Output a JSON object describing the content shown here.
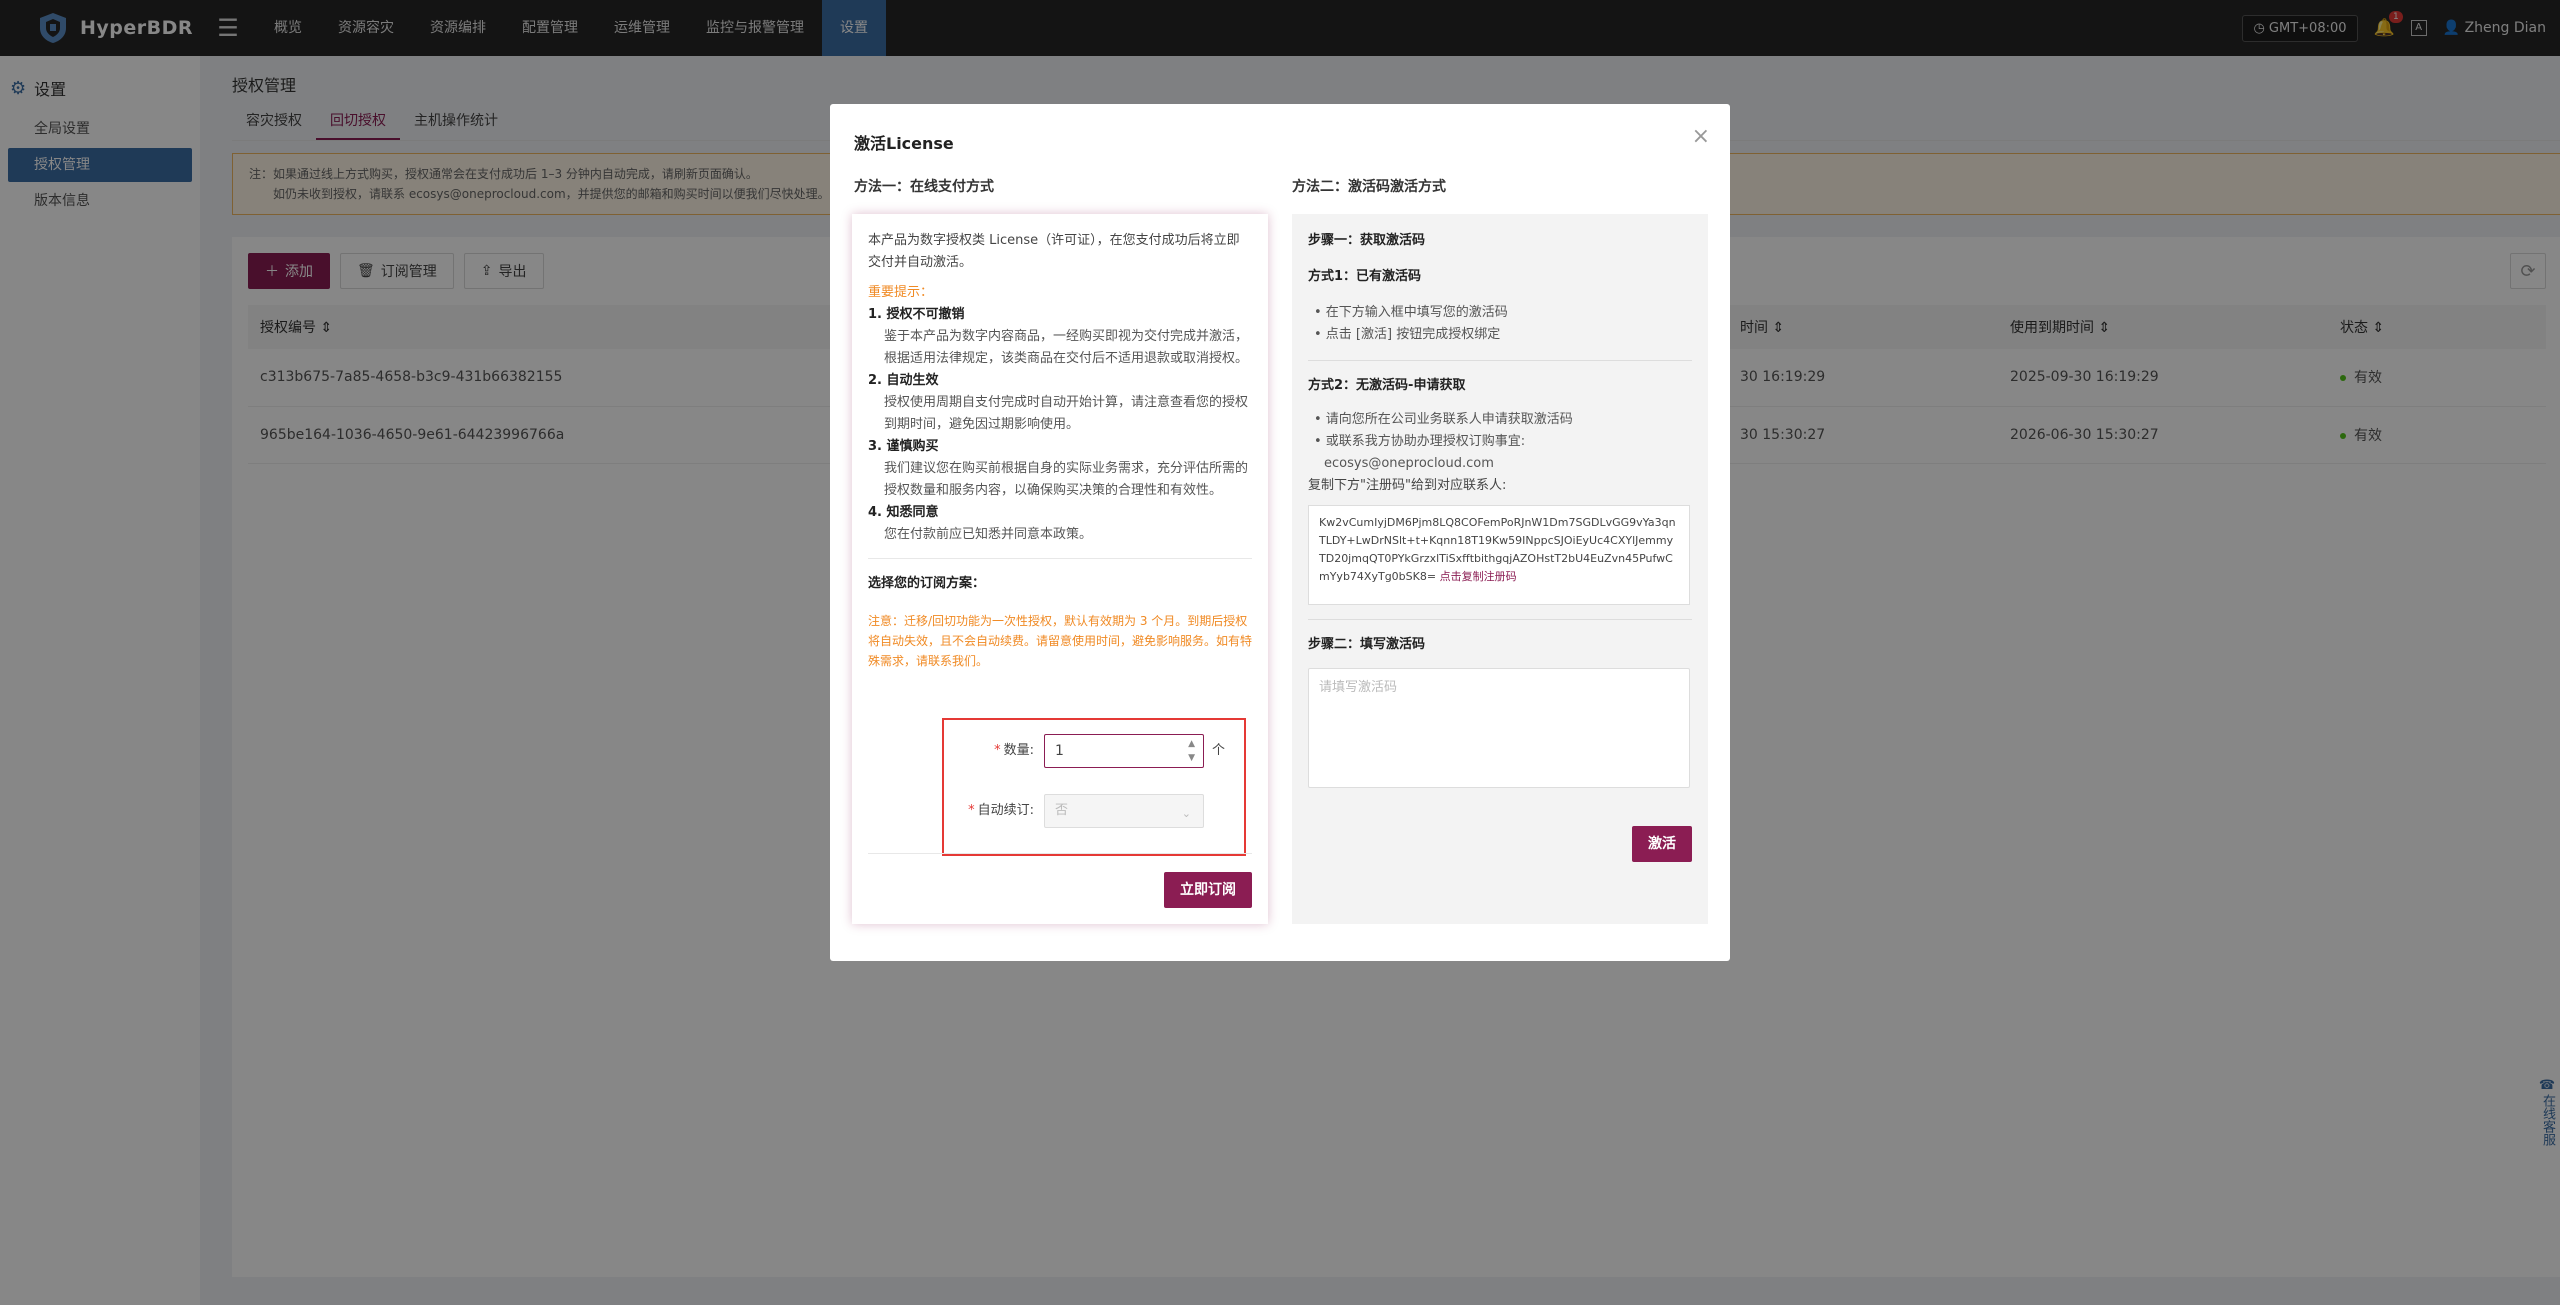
{
  "app": {
    "name": "HyperBDR"
  },
  "nav": [
    {
      "label": "概览"
    },
    {
      "label": "资源容灾"
    },
    {
      "label": "资源编排"
    },
    {
      "label": "配置管理"
    },
    {
      "label": "运维管理"
    },
    {
      "label": "监控与报警管理"
    },
    {
      "label": "设置"
    }
  ],
  "topbar": {
    "timezone": "GMT+08:00",
    "notification_count": "1",
    "lang": "A",
    "user": "Zheng Dian"
  },
  "sidebar": {
    "title": "设置",
    "items": [
      {
        "label": "全局设置"
      },
      {
        "label": "授权管理"
      },
      {
        "label": "版本信息"
      }
    ]
  },
  "page": {
    "title": "授权管理",
    "tabs": [
      {
        "label": "容灾授权"
      },
      {
        "label": "回切授权"
      },
      {
        "label": "主机操作统计"
      }
    ],
    "notice_line1": "注：如果通过线上方式购买，授权通常会在支付成功后 1–3 分钟内自动完成，请刷新页面确认。",
    "notice_line2": "如仍未收到授权，请联系 ecosys@oneprocloud.com，并提供您的邮箱和购买时间以便我们尽快处理。",
    "toolbar": {
      "add": "添加",
      "subscriptions": "订阅管理",
      "export": "导出"
    },
    "table": {
      "headers": [
        "授权编号",
        "时间",
        "使用到期时间",
        "状态"
      ],
      "rows": [
        {
          "id": "c313b675-7a85-4658-b3c9-431b66382155",
          "time": "30 16:19:29",
          "expire": "2025-09-30 16:19:29",
          "status": "有效"
        },
        {
          "id": "965be164-1036-4650-9e61-64423996766a",
          "time": "30 15:30:27",
          "expire": "2026-06-30 15:30:27",
          "status": "有效"
        }
      ]
    }
  },
  "modal": {
    "title": "激活License",
    "method1": {
      "title": "方法一：在线支付方式",
      "intro": "本产品为数字授权类 License（许可证），在您支付成功后将立即交付并自动激活。",
      "important": "重要提示：",
      "items": [
        {
          "h": "1. 授权不可撤销",
          "b": "鉴于本产品为数字内容商品，一经购买即视为交付完成并激活，根据适用法律规定，该类商品在交付后不适用退款或取消授权。"
        },
        {
          "h": "2. 自动生效",
          "b": "授权使用周期自支付完成时自动开始计算，请注意查看您的授权到期时间，避免因过期影响使用。"
        },
        {
          "h": "3. 谨慎购买",
          "b": "我们建议您在购买前根据自身的实际业务需求，充分评估所需的授权数量和服务内容，以确保购买决策的合理性和有效性。"
        },
        {
          "h": "4. 知悉同意",
          "b": "您在付款前应已知悉并同意本政策。"
        }
      ],
      "plan_title": "选择您的订阅方案：",
      "plan_warning": "注意：迁移/回切功能为一次性授权，默认有效期为 3 个月。到期后授权将自动失效，且不会自动续费。请留意使用时间，避免影响服务。如有特殊需求，请联系我们。",
      "qty_label": "数量:",
      "qty_value": "1",
      "qty_unit": "个",
      "renew_label": "自动续订:",
      "renew_value": "否",
      "subscribe_button": "立即订阅"
    },
    "method2": {
      "title": "方法二：激活码激活方式",
      "step1": "步骤一：获取激活码",
      "way1_title": "方式1：已有激活码",
      "way1_bullets": [
        "• 在下方输入框中填写您的激活码",
        "• 点击 [激活] 按钮完成授权绑定"
      ],
      "way2_title": "方式2：无激活码-申请获取",
      "way2_bullets": [
        "• 请向您所在公司业务联系人申请获取激活码",
        "• 或联系我方协助办理授权订购事宜:"
      ],
      "contact_email": "ecosys@oneprocloud.com",
      "copy_hint": "复制下方\"注册码\"给到对应联系人:",
      "reg_code": "Kw2vCumIyjDM6Pjm8LQ8COFemPoRJnW1Dm7SGDLvGG9vYa3qnTLDY+LwDrNSlt+t+Kqnn18T19Kw59INppcSJOiEyUc4CXYlJemmyTD20jmqQT0PYkGrzxlTiSxfftbithgqjAZOHstT2bU4EuZvn45PufwCmYyb74XyTg0bSK8=",
      "copy_link": "点击复制注册码",
      "step2": "步骤二：填写激活码",
      "activation_placeholder": "请填写激活码",
      "activate_button": "激活"
    }
  },
  "chat": {
    "label": "在线客服"
  },
  "colors": {
    "brand": "#8b1d53",
    "nav_active": "#3b6ea5",
    "warning": "#f08a24"
  }
}
